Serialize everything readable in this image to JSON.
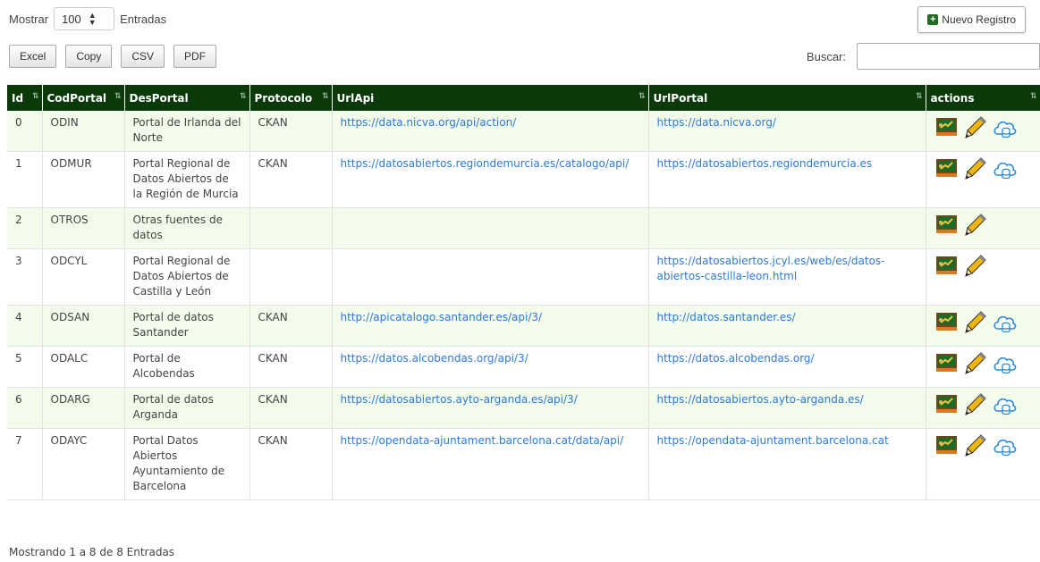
{
  "length": {
    "prefix": "Mostrar",
    "value": "100",
    "suffix": "Entradas"
  },
  "buttons": {
    "excel": "Excel",
    "copy": "Copy",
    "csv": "CSV",
    "pdf": "PDF"
  },
  "new_record": "Nuevo Registro",
  "search": {
    "label": "Buscar:",
    "value": ""
  },
  "columns": [
    "Id",
    "CodPortal",
    "DesPortal",
    "Protocolo",
    "UrlApi",
    "UrlPortal",
    "actions"
  ],
  "rows": [
    {
      "id": "0",
      "cod": "ODIN",
      "des": "Portal de Irlanda del Norte",
      "proto": "CKAN",
      "api": "https://data.nicva.org/api/action/",
      "portal": "https://data.nicva.org/",
      "cloud": true
    },
    {
      "id": "1",
      "cod": "ODMUR",
      "des": "Portal Regional de Datos Abiertos de la Región de Murcia",
      "proto": "CKAN",
      "api": "https://datosabiertos.regiondemurcia.es/catalogo/api/",
      "portal": "https://datosabiertos.regiondemurcia.es",
      "cloud": true
    },
    {
      "id": "2",
      "cod": "OTROS",
      "des": "Otras fuentes de datos",
      "proto": "",
      "api": "",
      "portal": "",
      "cloud": false
    },
    {
      "id": "3",
      "cod": "ODCYL",
      "des": "Portal Regional de Datos Abiertos de Castilla y León",
      "proto": "",
      "api": "",
      "portal": "https://datosabiertos.jcyl.es/web/es/datos-abiertos-castilla-leon.html",
      "cloud": false
    },
    {
      "id": "4",
      "cod": "ODSAN",
      "des": "Portal de datos Santander",
      "proto": "CKAN",
      "api": "http://apicatalogo.santander.es/api/3/",
      "portal": "http://datos.santander.es/",
      "cloud": true
    },
    {
      "id": "5",
      "cod": "ODALC",
      "des": "Portal de Alcobendas",
      "proto": "CKAN",
      "api": "https://datos.alcobendas.org/api/3/",
      "portal": "https://datos.alcobendas.org/",
      "cloud": true
    },
    {
      "id": "6",
      "cod": "ODARG",
      "des": "Portal de datos Arganda",
      "proto": "CKAN",
      "api": "https://datosabiertos.ayto-arganda.es/api/3/",
      "portal": "https://datosabiertos.ayto-arganda.es/",
      "cloud": true
    },
    {
      "id": "7",
      "cod": "ODAYC",
      "des": "Portal Datos Abiertos Ayuntamiento de Barcelona",
      "proto": "CKAN",
      "api": "https://opendata-ajuntament.barcelona.cat/data/api/",
      "portal": "https://opendata-ajuntament.barcelona.cat",
      "cloud": true
    }
  ],
  "footer": "Mostrando 1 a 8 de 8 Entradas",
  "icons": {
    "view": "presentation-board-icon",
    "edit": "pencil-icon",
    "cloud": "cloud-database-icon"
  },
  "colors": {
    "header_bg": "#0a3a0a",
    "row_alt": "#f3fbeb",
    "link": "#2b7ad8"
  }
}
